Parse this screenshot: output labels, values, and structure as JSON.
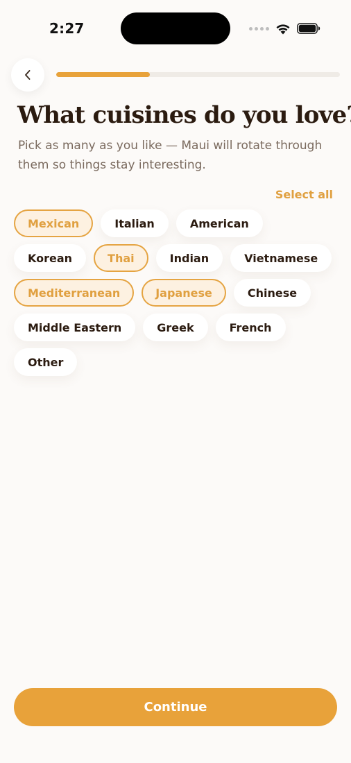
{
  "status_bar": {
    "time": "2:27",
    "icons": [
      "signal-dots-icon",
      "wifi-icon",
      "battery-icon"
    ]
  },
  "header": {
    "back_icon": "chevron-left-icon",
    "progress": 0.33
  },
  "title": "What cuisines do you love?",
  "subtitle": "Pick as many as you like — Maui will rotate through them so things stay interesting.",
  "select_all_label": "Select all",
  "cuisines": [
    {
      "label": "Mexican",
      "selected": true
    },
    {
      "label": "Italian",
      "selected": false
    },
    {
      "label": "American",
      "selected": false
    },
    {
      "label": "Korean",
      "selected": false
    },
    {
      "label": "Thai",
      "selected": true
    },
    {
      "label": "Indian",
      "selected": false
    },
    {
      "label": "Vietnamese",
      "selected": false
    },
    {
      "label": "Mediterranean",
      "selected": true
    },
    {
      "label": "Japanese",
      "selected": true
    },
    {
      "label": "Chinese",
      "selected": false
    },
    {
      "label": "Middle Eastern",
      "selected": false
    },
    {
      "label": "Greek",
      "selected": false
    },
    {
      "label": "French",
      "selected": false
    },
    {
      "label": "Other",
      "selected": false
    }
  ],
  "continue_label": "Continue",
  "colors": {
    "accent": "#E8A23A",
    "selected_chip_bg": "#FDF1E1",
    "title": "#2B1B10",
    "subtitle": "#7A6A5E",
    "background": "#FCFAF8"
  }
}
